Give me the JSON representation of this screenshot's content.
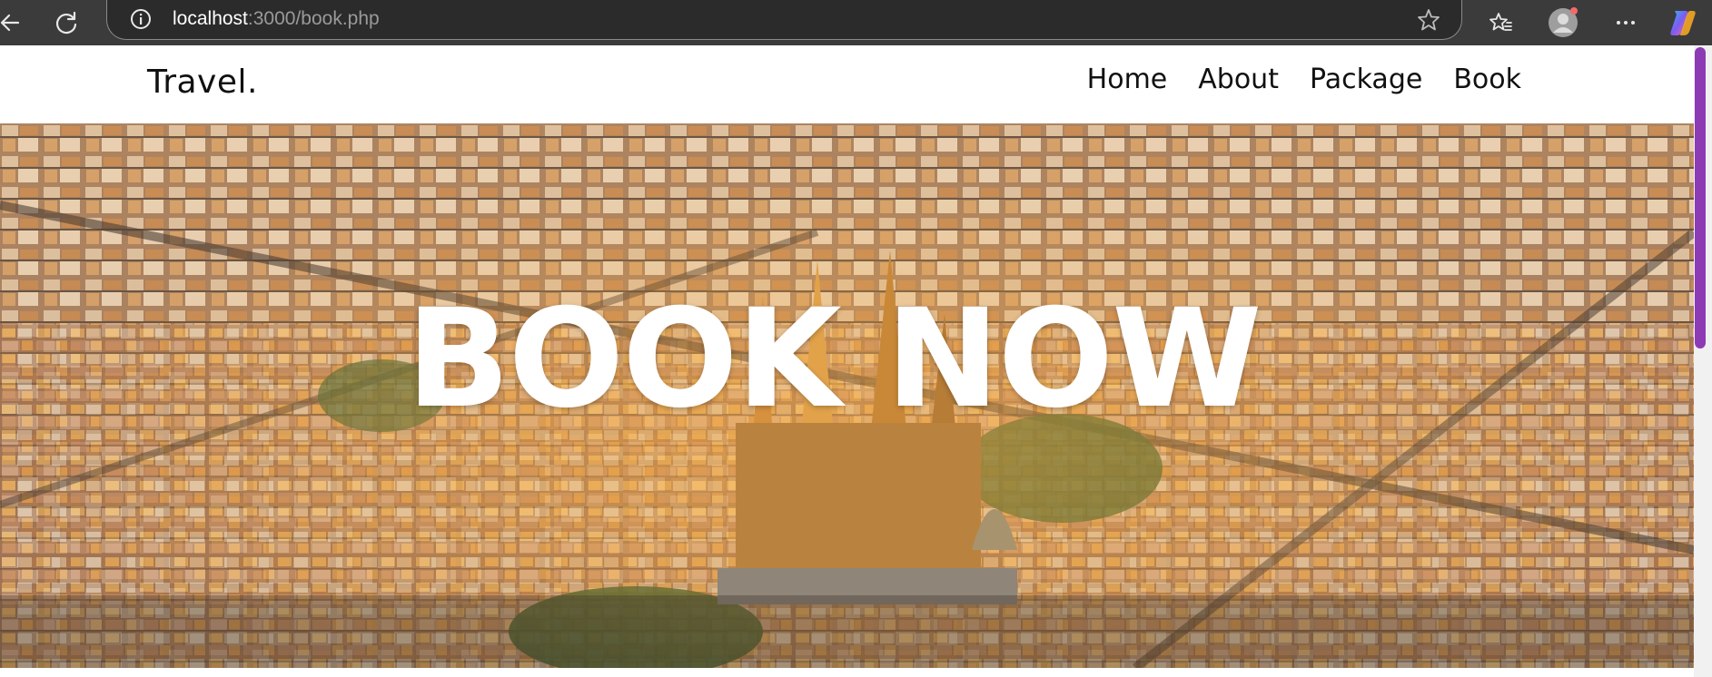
{
  "browser": {
    "url_host": "localhost",
    "url_rest": ":3000/book.php",
    "icons": [
      "back-icon",
      "refresh-icon",
      "info-icon",
      "star-icon",
      "favorites-icon",
      "profile-icon",
      "more-icon",
      "copilot-icon"
    ]
  },
  "site": {
    "logo": "Travel.",
    "nav": [
      {
        "label": "Home"
      },
      {
        "label": "About"
      },
      {
        "label": "Package"
      },
      {
        "label": "Book"
      }
    ]
  },
  "hero": {
    "title": "BOOK NOW",
    "image_subject": "aerial city view with cathedral"
  },
  "colors": {
    "chrome_bg": "#3b3b3b",
    "scroll_accent": "#8d3bb5",
    "hero_text": "#ffffff"
  }
}
